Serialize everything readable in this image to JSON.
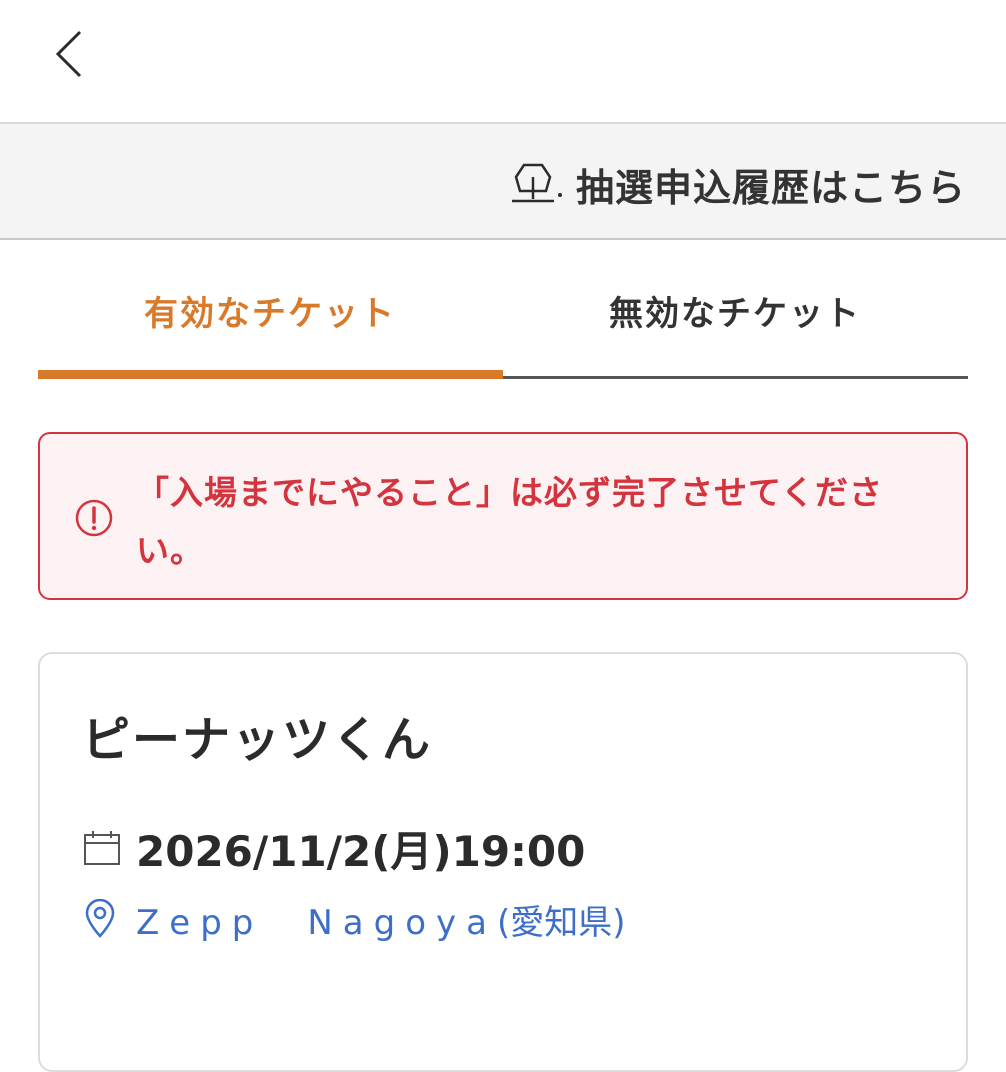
{
  "header": {
    "back_icon": "chevron-left-icon"
  },
  "history": {
    "label": "抽選申込履歴はこちら",
    "icon": "lottery-history-icon"
  },
  "tabs": [
    {
      "label": "有効なチケット",
      "active": true
    },
    {
      "label": "無効なチケット",
      "active": false
    }
  ],
  "alert": {
    "icon": "exclamation-circle-icon",
    "message": "「入場までにやること」は必ず完了させてください。"
  },
  "ticket": {
    "title": "ピーナッツくん",
    "date": "2026/11/2(月)19:00",
    "venue": "Zepp　Nagoya",
    "prefecture": "(愛知県)"
  },
  "colors": {
    "accent": "#d97a2b",
    "alert": "#d4343e",
    "link": "#3d6fc8"
  }
}
